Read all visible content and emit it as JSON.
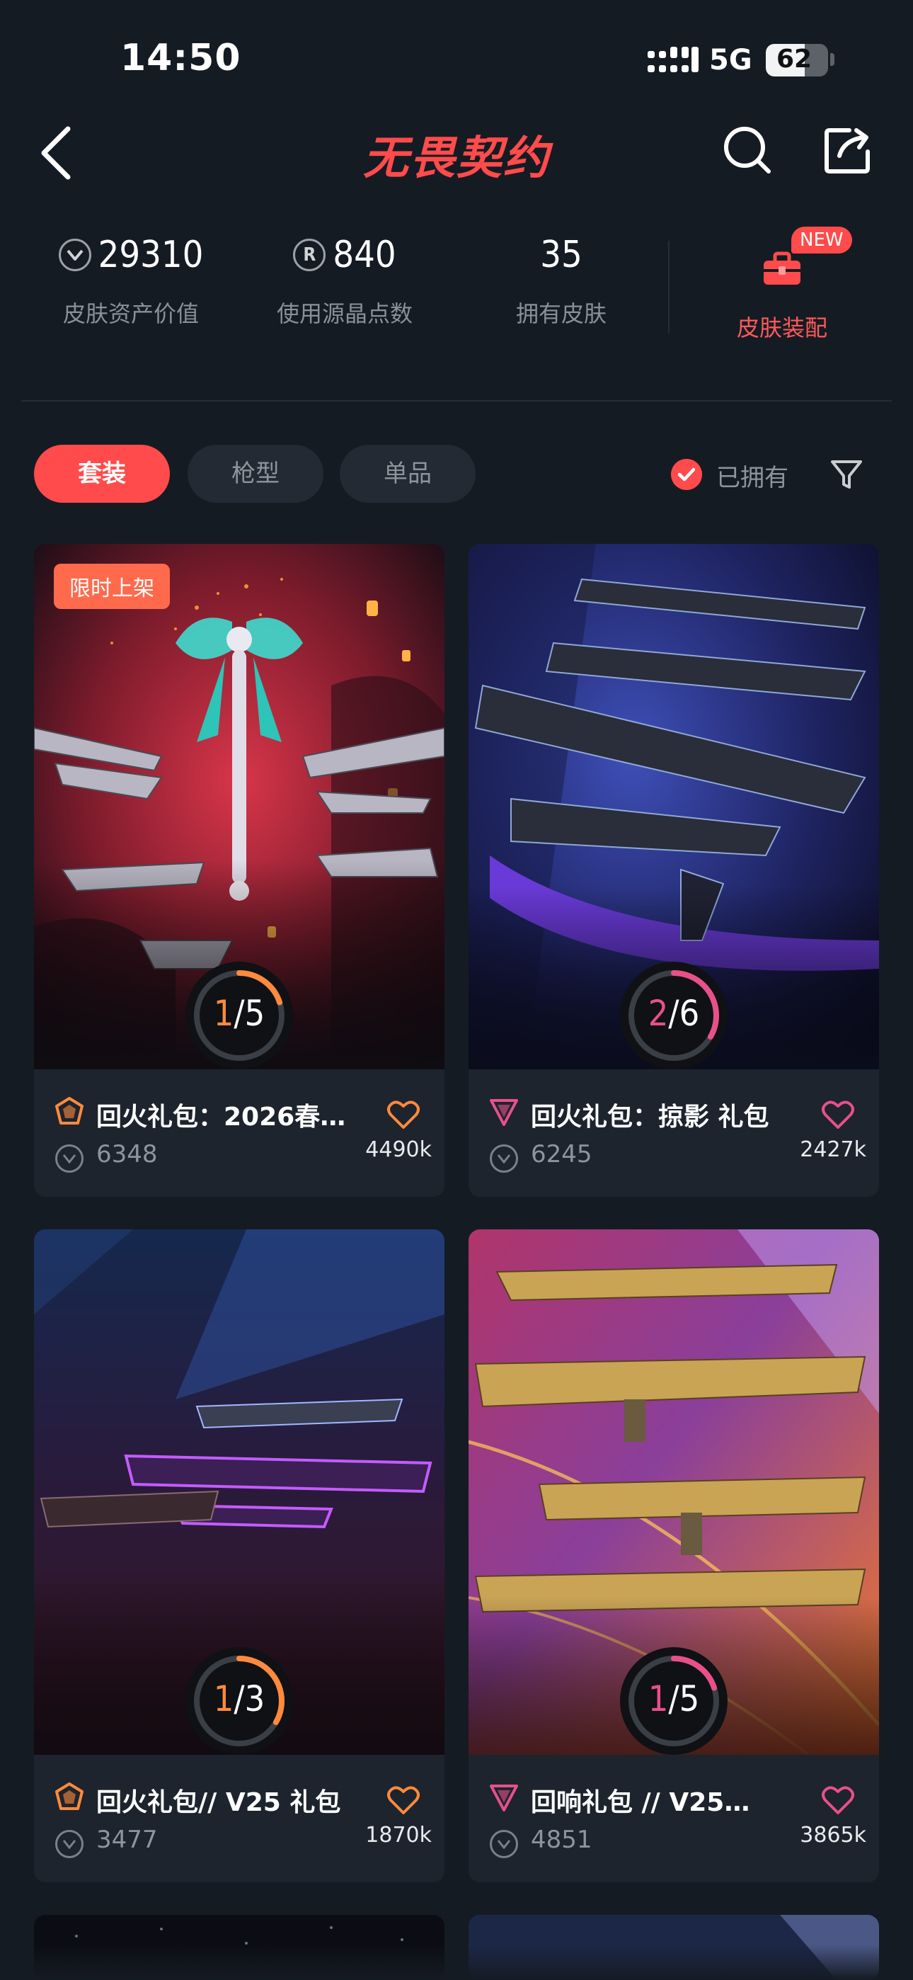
{
  "status": {
    "time": "14:50",
    "network": "5G",
    "battery": "62",
    "battery_level": 0.62
  },
  "header": {
    "title": "无畏契约"
  },
  "stats": [
    {
      "value": "29310",
      "label": "皮肤资产价值",
      "icon": "vp-coin-icon"
    },
    {
      "value": "840",
      "label": "使用源晶点数",
      "icon": "radianite-icon"
    },
    {
      "value": "35",
      "label": "拥有皮肤",
      "icon": ""
    }
  ],
  "equip": {
    "label": "皮肤装配",
    "badge": "NEW",
    "icon": "toolbox-icon"
  },
  "tabs": [
    {
      "label": "套装",
      "active": true
    },
    {
      "label": "枪型",
      "active": false
    },
    {
      "label": "单品",
      "active": false
    }
  ],
  "owned_filter": {
    "label": "已拥有",
    "checked": true
  },
  "colors": {
    "accent": "#ff4b4b",
    "ring_orange": "#ff8a3d",
    "ring_pink": "#e8508a",
    "tier_orange": "#ff8a3d",
    "tier_pink": "#e8508a"
  },
  "cards": [
    {
      "title": "回火礼包：2026春…",
      "price": "6348",
      "likes": "4490k",
      "progress_current": "1",
      "progress_total": "5",
      "tier": "premium-tier-icon",
      "heart_color": "#ff8a3d",
      "badge": "限时上架"
    },
    {
      "title": "回火礼包：掠影 礼包",
      "price": "6245",
      "likes": "2427k",
      "progress_current": "2",
      "progress_total": "6",
      "tier": "exclusive-tier-icon",
      "heart_color": "#e8508a",
      "badge": ""
    },
    {
      "title": "回火礼包// V25 礼包",
      "price": "3477",
      "likes": "1870k",
      "progress_current": "1",
      "progress_total": "3",
      "tier": "premium-tier-icon",
      "heart_color": "#ff8a3d",
      "badge": ""
    },
    {
      "title": "回响礼包 // V25…",
      "price": "4851",
      "likes": "3865k",
      "progress_current": "1",
      "progress_total": "5",
      "tier": "exclusive-tier-icon",
      "heart_color": "#e8508a",
      "badge": ""
    }
  ]
}
